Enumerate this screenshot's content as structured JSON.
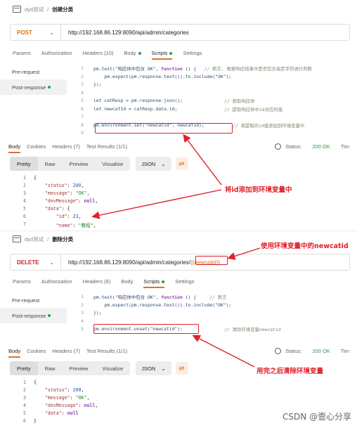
{
  "req1": {
    "breadcrumb_ws": "dyd测试",
    "breadcrumb_sep": "/",
    "breadcrumb_name": "创建分类",
    "method": "POST",
    "url": "http://192.168.86.129:8090/api/admin/categories",
    "tabs": [
      "Params",
      "Authorization",
      "Headers (10)",
      "Body",
      "Scripts",
      "Settings"
    ],
    "side": [
      "Pre-request",
      "Post-response"
    ],
    "lines": [
      "1",
      "2",
      "3",
      "4",
      "5",
      "6",
      "7",
      "8",
      "9"
    ],
    "code": {
      "l1a": "pm.test(\"响应体中包含 OK\", ",
      "l1b": "function",
      "l1c": " () {   ",
      "l1d": "// 断言, 根据响应结果中是否包含指定字符进行判断",
      "l2": "    pm.expect(pm.response.text()).to.include(\"OK\");",
      "l3": "});",
      "l5a": "let catResp = pm.response.json();",
      "l5b": "// 获取响应体",
      "l6a": "let newcatId = catResp.data.id;",
      "l6b": "// 提取响应体中id对应的值",
      "l8a": "pm.environment.set(\"newcatid\", newcatId);",
      "l8b": "// 将提取的id值添加到环境变量中"
    },
    "resp_tabs": [
      "Body",
      "Cookies",
      "Headers (7)",
      "Test Results (1/1)"
    ],
    "status_label": "Status:",
    "status_value": "200 OK",
    "time_label": "Tim",
    "view_modes": [
      "Pretty",
      "Raw",
      "Preview",
      "Visualize"
    ],
    "format": "JSON",
    "json_lines": [
      "1",
      "2",
      "3",
      "4",
      "5",
      "6",
      "7"
    ],
    "json": {
      "l1": "{",
      "l2k": "\"status\"",
      "l2v": "200",
      "l3k": "\"message\"",
      "l3v": "\"OK\"",
      "l4k": "\"devMessage\"",
      "l4v": "null",
      "l5k": "\"data\"",
      "l5v": "{",
      "l6k": "\"id\"",
      "l6v": "23",
      "l7k": "\"name\"",
      "l7v": "\"教程\""
    }
  },
  "req2": {
    "breadcrumb_ws": "dyd测试",
    "breadcrumb_sep": "/",
    "breadcrumb_name": "删除分类",
    "method": "DELETE",
    "url_prefix": "http://192.168.86.129:8090/api/admin/categories/",
    "url_var": "{{newcatid}}",
    "tabs": [
      "Params",
      "Authorization",
      "Headers (8)",
      "Body",
      "Scripts",
      "Settings"
    ],
    "side": [
      "Pre-request",
      "Post-response"
    ],
    "lines": [
      "1",
      "2",
      "3",
      "4",
      "5"
    ],
    "code": {
      "l1a": "pm.test(\"响应体中包含 OK\", ",
      "l1b": "function",
      "l1c": " () {     ",
      "l1d": "// 断言",
      "l2": "    pm.expect(pm.response.text()).to.include(\"OK\");",
      "l3": "});",
      "l5a": "pm.environment.unset(\"newcatid\");",
      "l5b": "// 清除环境变量newcatid"
    },
    "resp_tabs": [
      "Body",
      "Cookies",
      "Headers (7)",
      "Test Results (1/1)"
    ],
    "status_label": "Status:",
    "status_value": "200 OK",
    "time_label": "Tim",
    "view_modes": [
      "Pretty",
      "Raw",
      "Preview",
      "Visualize"
    ],
    "format": "JSON",
    "json_lines": [
      "1",
      "2",
      "3",
      "4",
      "5",
      "6"
    ],
    "json": {
      "l1": "{",
      "l2k": "\"status\"",
      "l2v": "200",
      "l3k": "\"message\"",
      "l3v": "\"OK\"",
      "l4k": "\"devMessage\"",
      "l4v": "null",
      "l5k": "\"data\"",
      "l5v": "null",
      "l6": "}"
    }
  },
  "annotations": {
    "add_env": "将id添加到环境变量中",
    "use_env": "使用环境变量中的newcatid",
    "clear_env": "用完之后清除环境变量",
    "color": "#e0202a"
  },
  "watermark": "CSDN @壹心分享",
  "colors": {
    "accent": "#e2702e",
    "ok": "#2d9e3f",
    "post": "#d9720f"
  }
}
